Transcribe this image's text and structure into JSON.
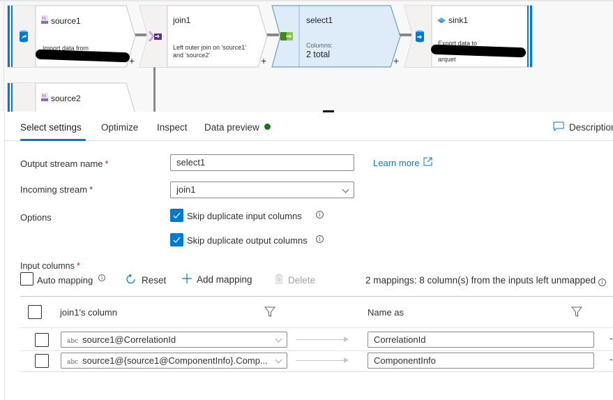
{
  "canvas": {
    "nodes": [
      {
        "id": "source1",
        "title": "source1",
        "title_icon": "source-dataset-icon",
        "main_icon": "source-database-icon",
        "description_lines": [
          "Import data from",
          "[redacted] Provider"
        ],
        "redacted": true,
        "plus": "+"
      },
      {
        "id": "join1",
        "title": "join1",
        "main_icon": "join-icon",
        "description_lines": [
          "Left outer join on 'source1'",
          "and 'source2'"
        ],
        "plus": "+"
      },
      {
        "id": "select1",
        "title": "select1",
        "main_icon": "select-icon",
        "caption": "Columns:",
        "value": "2 total",
        "selected": true,
        "plus": "+"
      },
      {
        "id": "sink1",
        "title": "sink1",
        "title_icon": "sink-dataset-icon",
        "main_icon": "sink-database-icon",
        "description_lines": [
          "Export data to",
          "[redacted]",
          "arquet"
        ],
        "redacted": true
      }
    ],
    "partial_node": {
      "id": "source2",
      "title": "source2",
      "title_icon": "source-dataset-icon"
    }
  },
  "panel": {
    "tabs": [
      {
        "label": "Select settings",
        "active": true
      },
      {
        "label": "Optimize",
        "active": false
      },
      {
        "label": "Inspect",
        "active": false
      },
      {
        "label": "Data preview",
        "active": false,
        "status": "green-dot"
      }
    ],
    "description_button": "Description",
    "form": {
      "output_stream_label": "Output stream name",
      "output_stream_value": "select1",
      "incoming_stream_label": "Incoming stream",
      "incoming_stream_value": "join1",
      "required_mark": "*",
      "learn_more": "Learn more",
      "options_label": "Options",
      "options": [
        {
          "label": "Skip duplicate input columns",
          "checked": true
        },
        {
          "label": "Skip duplicate output columns",
          "checked": true
        }
      ]
    },
    "input_columns": {
      "label": "Input columns",
      "auto_mapping": {
        "label": "Auto mapping",
        "checked": false
      },
      "reset": "Reset",
      "add_mapping": "Add mapping",
      "delete": "Delete",
      "summary": "2 mappings: 8 column(s) from the inputs left unmapped",
      "headers": {
        "source": "join1's column",
        "target": "Name as"
      },
      "rows": [
        {
          "type": "abc",
          "source": "source1@CorrelationId",
          "target": "CorrelationId"
        },
        {
          "type": "abc",
          "source": "source1@{source1@ComponentInfo}.Comp...",
          "target": "ComponentInfo"
        }
      ]
    }
  },
  "colors": {
    "accent": "#0078d4",
    "selected_node_bg": "#deecf9",
    "status_ok": "#107c10",
    "required": "#a4262c"
  }
}
